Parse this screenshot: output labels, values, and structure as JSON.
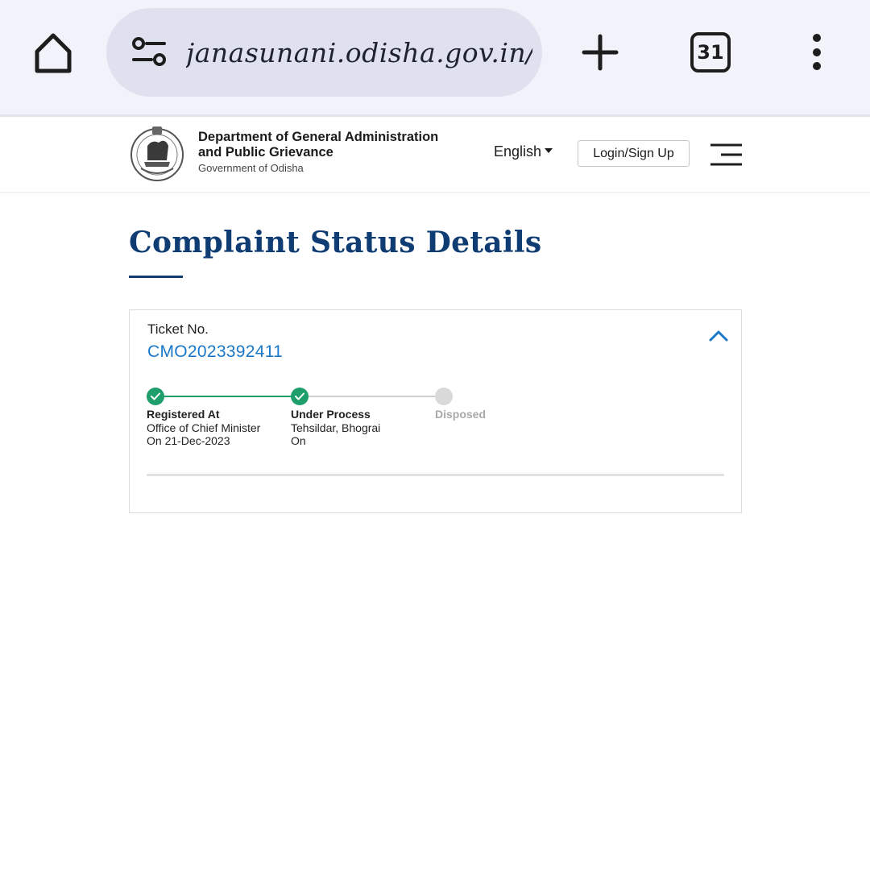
{
  "browser": {
    "url": "janasunani.odisha.gov.in/Con",
    "tab_count": "31"
  },
  "header": {
    "dept_line1": "Department of General Administration",
    "dept_line2": "and Public Grievance",
    "dept_sub": "Government of Odisha",
    "language": "English",
    "login_label": "Login/Sign Up"
  },
  "page": {
    "title": "Complaint Status Details"
  },
  "ticket": {
    "label": "Ticket No.",
    "number": "CMO2023392411"
  },
  "steps": [
    {
      "title": "Registered At",
      "line1": "Office of Chief Minister",
      "line2": "On 21-Dec-2023",
      "status": "done"
    },
    {
      "title": "Under Process",
      "line1": "Tehsildar, Bhograi",
      "line2": "On",
      "status": "done"
    },
    {
      "title": "Disposed",
      "line1": "",
      "line2": "",
      "status": "pending"
    }
  ],
  "colors": {
    "brand_navy": "#0f3c73",
    "link_blue": "#1b78c8",
    "step_done": "#1e9e6b",
    "step_pending": "#d9d9d9"
  },
  "icons": {
    "home": "home-icon",
    "site_settings": "tune-icon",
    "new_tab": "plus-icon",
    "tabs": "tab-count-icon",
    "overflow": "more-vert-icon",
    "emblem": "odisha-emblem-icon",
    "menu": "hamburger-icon",
    "collapse": "chevron-up-icon",
    "step_done": "check-icon"
  }
}
